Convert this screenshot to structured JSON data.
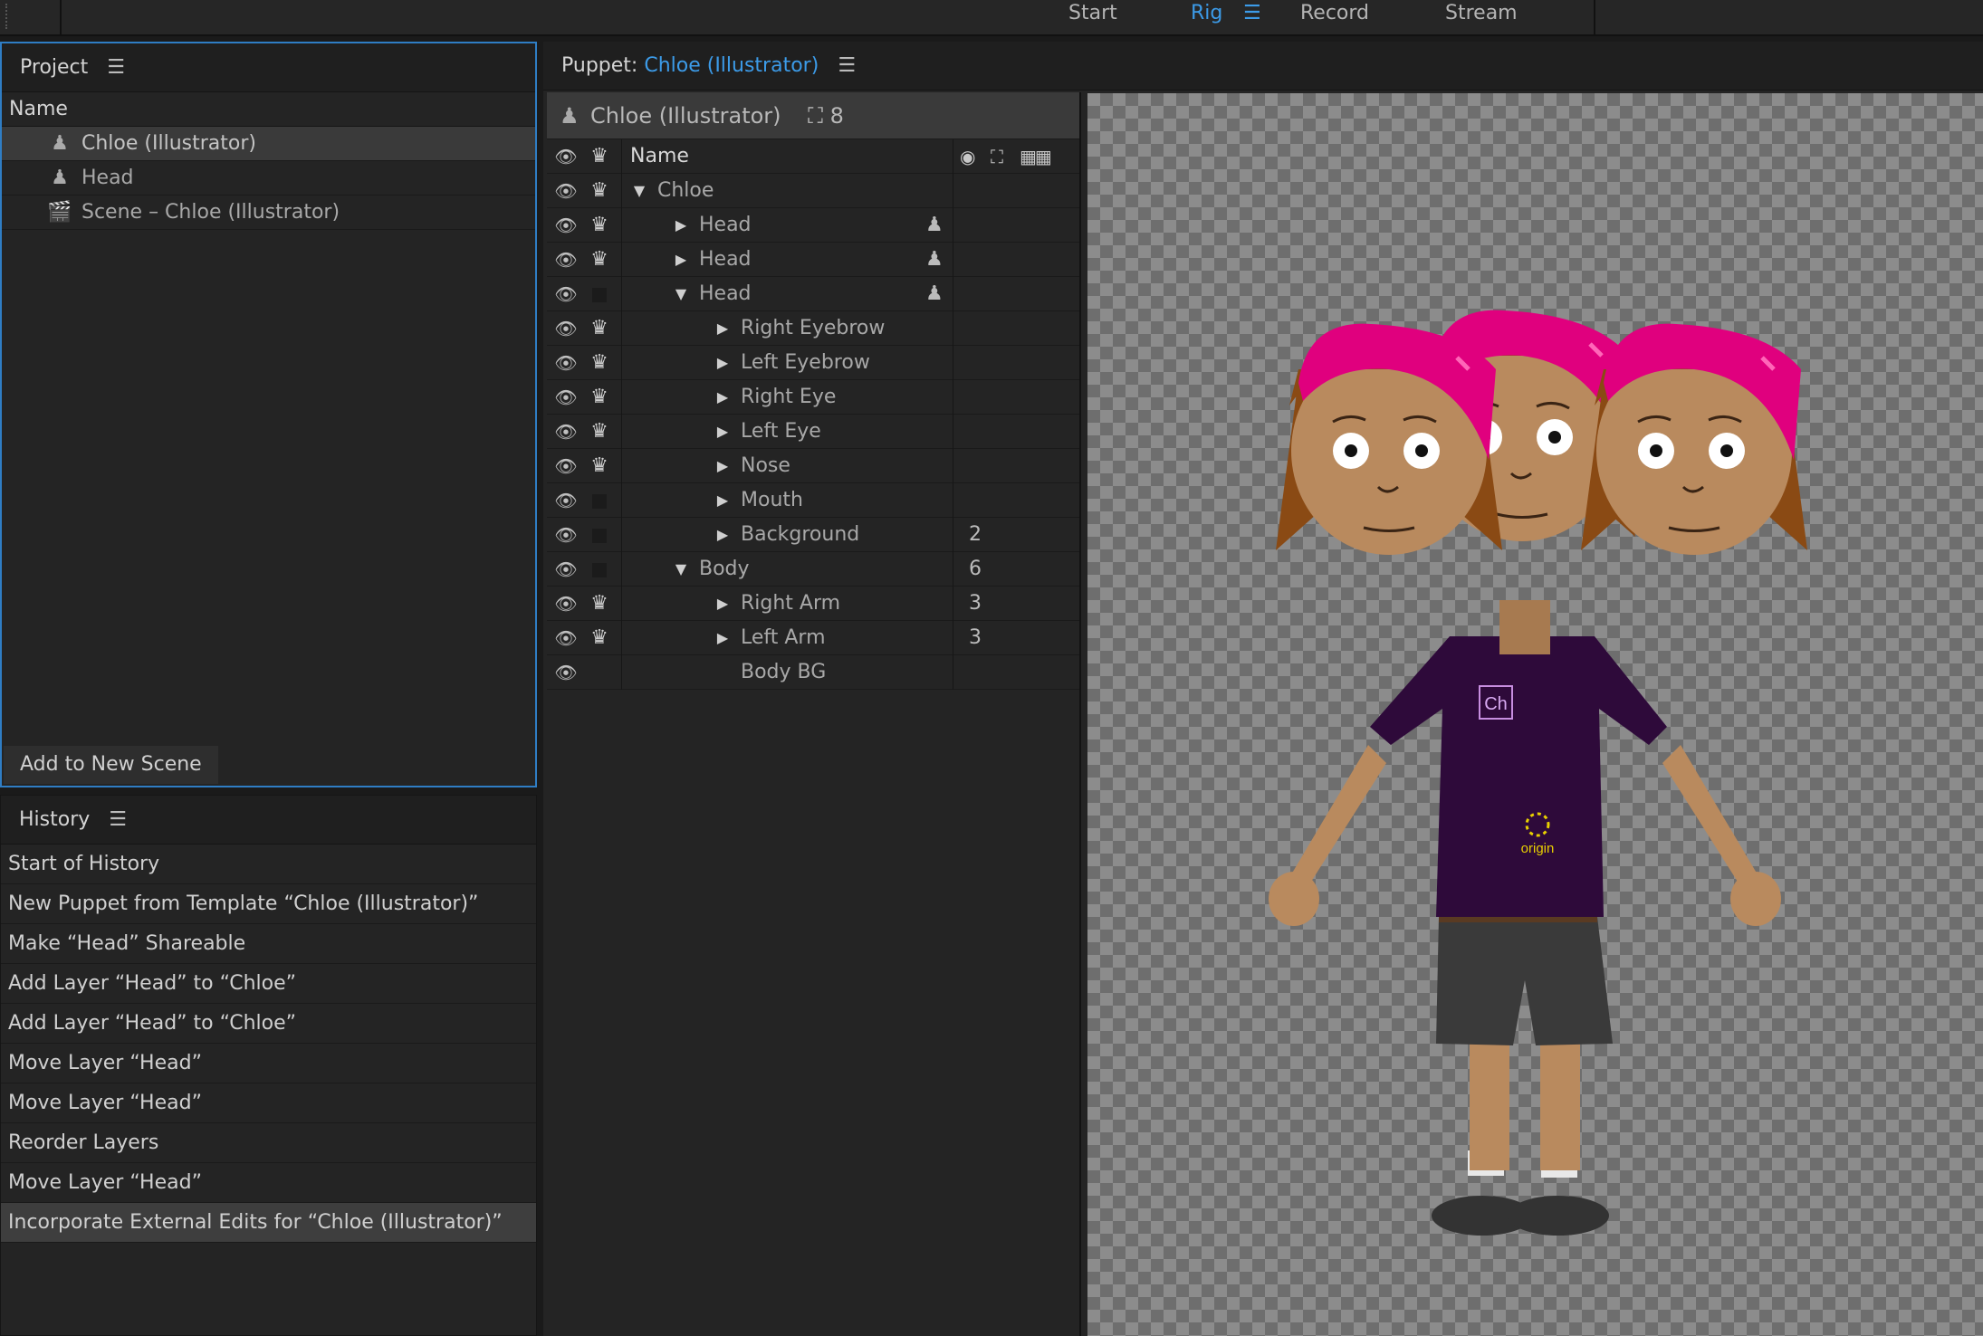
{
  "workspace": {
    "tabs": [
      "Start",
      "Rig",
      "Record",
      "Stream"
    ],
    "active": "Rig"
  },
  "project": {
    "title": "Project",
    "column": "Name",
    "items": [
      {
        "label": "Chloe (Illustrator)",
        "icon": "puppet-icon"
      },
      {
        "label": "Head",
        "icon": "puppet-icon"
      },
      {
        "label": "Scene – Chloe (Illustrator)",
        "icon": "clapperboard-icon"
      }
    ],
    "add_button": "Add to New Scene"
  },
  "history": {
    "title": "History",
    "items": [
      "Start of History",
      "New Puppet from Template “Chloe (Illustrator)”",
      "Make “Head” Shareable",
      "Add Layer “Head” to “Chloe”",
      "Add Layer “Head” to “Chloe”",
      "Move Layer “Head”",
      "Move Layer “Head”",
      "Reorder Layers",
      "Move Layer “Head”",
      "Incorporate External Edits for “Chloe (Illustrator)”"
    ]
  },
  "puppet": {
    "title_prefix": "Puppet:",
    "title_name": "Chloe (Illustrator)",
    "top_name": "Chloe (Illustrator)",
    "top_count": "8",
    "column": "Name",
    "layers": [
      {
        "name": "Chloe",
        "depth": 0,
        "twirl": "open",
        "crown": true,
        "puppet": false,
        "count": ""
      },
      {
        "name": "Head",
        "depth": 1,
        "twirl": "closed",
        "crown": true,
        "puppet": true,
        "count": ""
      },
      {
        "name": "Head",
        "depth": 1,
        "twirl": "closed",
        "crown": true,
        "puppet": true,
        "count": ""
      },
      {
        "name": "Head",
        "depth": 1,
        "twirl": "open",
        "crown": false,
        "puppet": true,
        "count": ""
      },
      {
        "name": "Right Eyebrow",
        "depth": 2,
        "twirl": "closed",
        "crown": true,
        "puppet": false,
        "count": ""
      },
      {
        "name": "Left Eyebrow",
        "depth": 2,
        "twirl": "closed",
        "crown": true,
        "puppet": false,
        "count": ""
      },
      {
        "name": "Right Eye",
        "depth": 2,
        "twirl": "closed",
        "crown": true,
        "puppet": false,
        "count": ""
      },
      {
        "name": "Left Eye",
        "depth": 2,
        "twirl": "closed",
        "crown": true,
        "puppet": false,
        "count": ""
      },
      {
        "name": "Nose",
        "depth": 2,
        "twirl": "closed",
        "crown": true,
        "puppet": false,
        "count": ""
      },
      {
        "name": "Mouth",
        "depth": 2,
        "twirl": "closed",
        "crown": false,
        "puppet": false,
        "count": ""
      },
      {
        "name": "Background",
        "depth": 2,
        "twirl": "closed",
        "crown": false,
        "puppet": false,
        "count": "2"
      },
      {
        "name": "Body",
        "depth": 1,
        "twirl": "open",
        "crown": false,
        "puppet": false,
        "count": "6"
      },
      {
        "name": "Right Arm",
        "depth": 2,
        "twirl": "closed",
        "crown": true,
        "puppet": false,
        "count": "3"
      },
      {
        "name": "Left Arm",
        "depth": 2,
        "twirl": "closed",
        "crown": true,
        "puppet": false,
        "count": "3"
      },
      {
        "name": "Body BG",
        "depth": 2,
        "twirl": "none",
        "crown": false,
        "puppet": false,
        "count": ""
      }
    ]
  },
  "stage": {
    "shirt_logo": "Ch",
    "origin_label": "origin"
  },
  "colors": {
    "accent": "#3c9be8",
    "hair": "#e0007e",
    "shirt": "#2e0a3a",
    "skin": "#b98a5e",
    "origin": "#e8d000"
  }
}
